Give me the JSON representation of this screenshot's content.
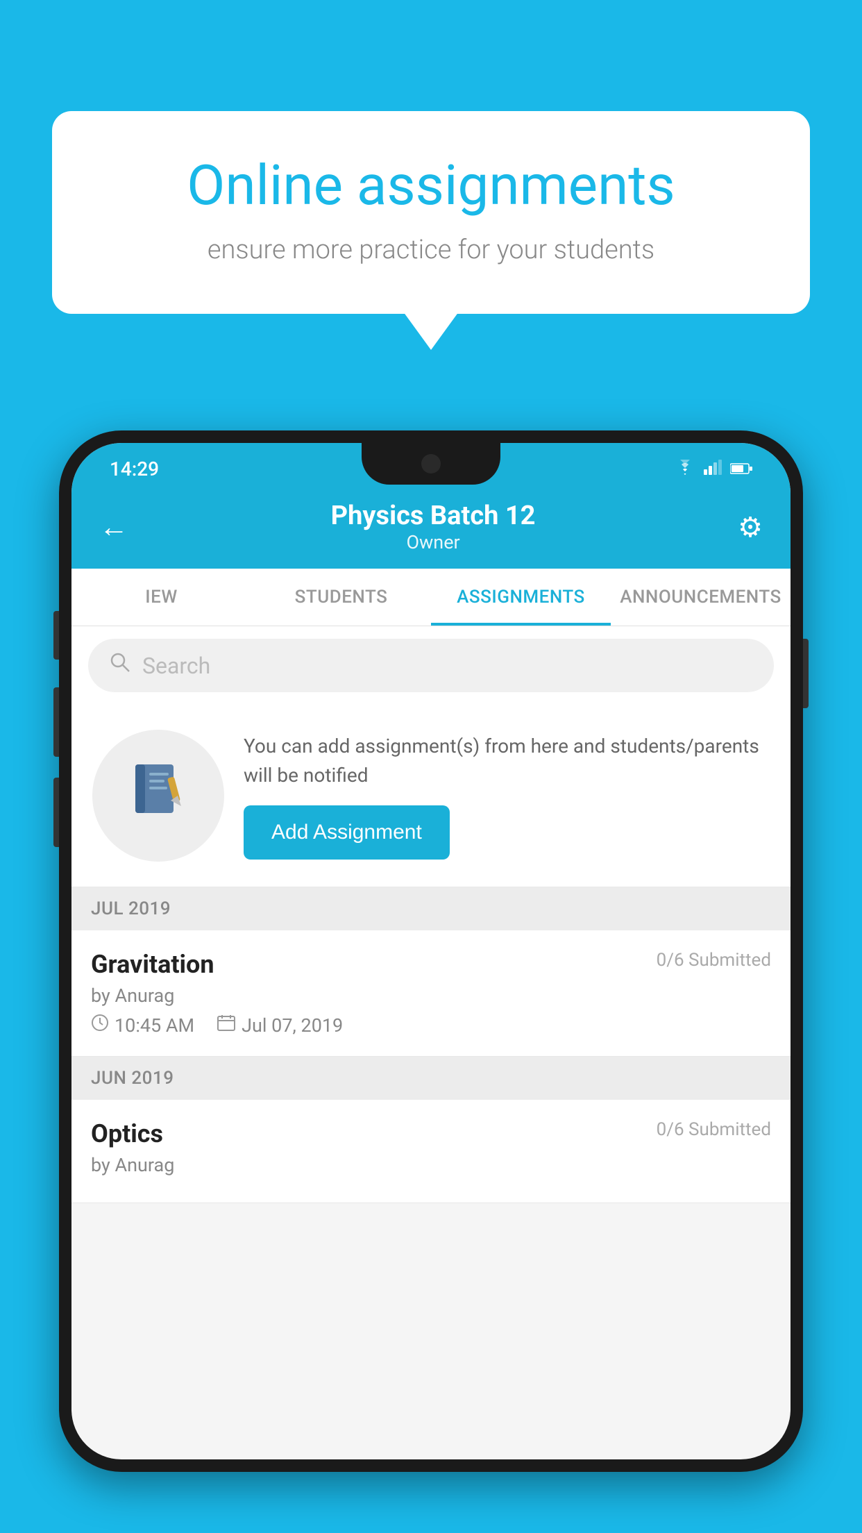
{
  "background_color": "#1ab8e8",
  "speech_bubble": {
    "title": "Online assignments",
    "subtitle": "ensure more practice for your students"
  },
  "status_bar": {
    "time": "14:29",
    "wifi_icon": "wifi",
    "signal_icon": "signal",
    "battery_icon": "battery"
  },
  "header": {
    "title": "Physics Batch 12",
    "subtitle": "Owner",
    "back_label": "←",
    "settings_label": "⚙"
  },
  "tabs": [
    {
      "label": "IEW",
      "active": false
    },
    {
      "label": "STUDENTS",
      "active": false
    },
    {
      "label": "ASSIGNMENTS",
      "active": true
    },
    {
      "label": "ANNOUNCEMENTS",
      "active": false
    }
  ],
  "search": {
    "placeholder": "Search"
  },
  "empty_state": {
    "description": "You can add assignment(s) from here and students/parents will be notified",
    "button_label": "Add Assignment"
  },
  "sections": [
    {
      "month": "JUL 2019",
      "assignments": [
        {
          "title": "Gravitation",
          "submitted": "0/6 Submitted",
          "by": "by Anurag",
          "time": "10:45 AM",
          "date": "Jul 07, 2019"
        }
      ]
    },
    {
      "month": "JUN 2019",
      "assignments": [
        {
          "title": "Optics",
          "submitted": "0/6 Submitted",
          "by": "by Anurag",
          "time": "",
          "date": ""
        }
      ]
    }
  ]
}
